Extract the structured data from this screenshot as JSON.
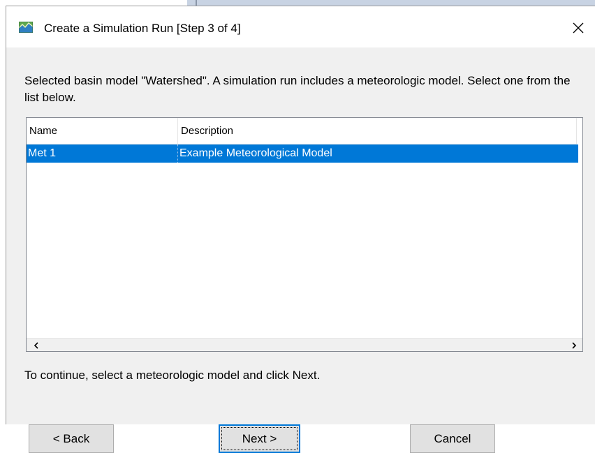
{
  "window": {
    "title": "Create a Simulation Run [Step 3 of 4]",
    "icon": "hec-hms-app-icon",
    "close_icon": "close-icon"
  },
  "instructions": "Selected basin model \"Watershed\". A simulation run includes a meteorologic model. Select one from the list below.",
  "table": {
    "columns": [
      "Name",
      "Description"
    ],
    "rows": [
      {
        "name": "Met 1",
        "description": "Example Meteorological Model",
        "selected": true
      }
    ],
    "selection_color": "#0078d7"
  },
  "scrollbar": {
    "left_icon": "chevron-left-icon",
    "right_icon": "chevron-right-icon"
  },
  "hint": "To continue, select a meteorologic model and click Next.",
  "buttons": {
    "back": "< Back",
    "next": "Next >",
    "cancel": "Cancel"
  }
}
